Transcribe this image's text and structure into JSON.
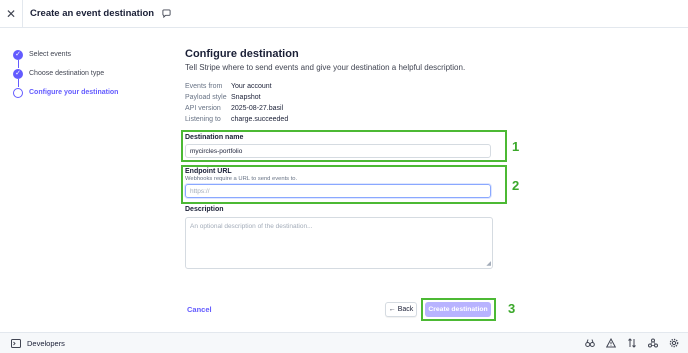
{
  "header": {
    "title": "Create an event destination",
    "close_icon": "close-icon",
    "feedback_icon": "chat-bubble-icon"
  },
  "steps": [
    {
      "label": "Select events",
      "state": "done"
    },
    {
      "label": "Choose destination type",
      "state": "done"
    },
    {
      "label": "Configure your destination",
      "state": "current"
    }
  ],
  "main": {
    "title": "Configure destination",
    "subtitle": "Tell Stripe where to send events and give your destination a helpful description.",
    "info": [
      {
        "key": "Events from",
        "value": "Your account"
      },
      {
        "key": "Payload style",
        "value": "Snapshot"
      },
      {
        "key": "API version",
        "value": "2025-08-27.basil"
      },
      {
        "key": "Listening to",
        "value": "charge.succeeded"
      }
    ],
    "destination_name": {
      "label": "Destination name",
      "value": "mycircles-portfolio"
    },
    "endpoint_url": {
      "label": "Endpoint URL",
      "help": "Webhooks require a URL to send events to.",
      "placeholder": "https://"
    },
    "description": {
      "label": "Description",
      "placeholder": "An optional description of the destination..."
    }
  },
  "annotations": [
    "1",
    "2",
    "3"
  ],
  "actions": {
    "cancel": "Cancel",
    "back": "Back",
    "create": "Create destination"
  },
  "footer": {
    "label": "Developers",
    "icons": [
      "binoculars-icon",
      "warning-icon",
      "sort-arrows-icon",
      "webhook-icon",
      "gear-icon"
    ]
  },
  "colors": {
    "accent": "#635bff",
    "annotation_green": "#4cb934",
    "create_button_disabled": "#b8b3ff"
  }
}
